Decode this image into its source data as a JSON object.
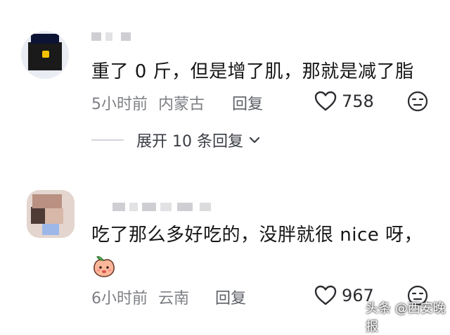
{
  "comments": [
    {
      "text": "重了 0 斤，但是增了肌，那就是减了脂",
      "time": "5小时前",
      "location": "内蒙古",
      "reply_label": "回复",
      "likes": "758",
      "expand_label": "展开 10 条回复"
    },
    {
      "text": "吃了那么多好吃的，没胖就很 nice 呀，",
      "time": "6小时前",
      "location": "云南",
      "reply_label": "回复",
      "likes": "967"
    }
  ],
  "watermark": "头条 @西安晚报",
  "icons": [
    "heart-icon",
    "dislike-face-icon",
    "chevron-down-icon",
    "peach-emoji-icon"
  ],
  "colors": {
    "text": "#161616",
    "meta": "#7d7f84",
    "divider": "#d4d6da"
  }
}
